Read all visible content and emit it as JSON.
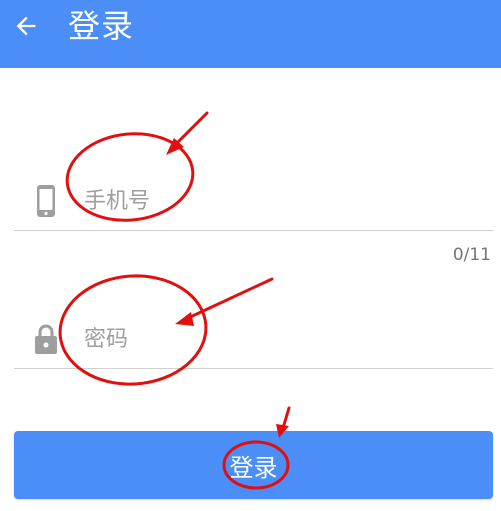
{
  "header": {
    "title": "登录",
    "back_icon": "arrow-left-icon"
  },
  "phone_field": {
    "placeholder": "手机号",
    "value": "",
    "icon": "phone-icon",
    "counter": "0/11"
  },
  "password_field": {
    "placeholder": "密码",
    "value": "",
    "icon": "lock-icon"
  },
  "login_button": {
    "label": "登录"
  },
  "colors": {
    "primary": "#4b8ef7",
    "annotation": "#e01010",
    "placeholder": "#9e9e9e",
    "icon": "#9e9e9e"
  }
}
